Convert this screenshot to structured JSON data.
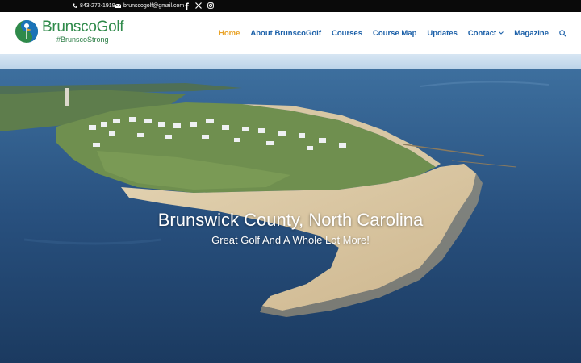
{
  "topbar": {
    "phone": "843-272-1919",
    "email": "brunscogolf@gmail.com",
    "social": [
      "facebook-icon",
      "x-icon",
      "instagram-icon"
    ]
  },
  "header": {
    "logo_title": "BrunscoGolf",
    "logo_tagline": "#BrunscoStrong",
    "nav": [
      {
        "label": "Home",
        "active": true
      },
      {
        "label": "About BrunscoGolf"
      },
      {
        "label": "Courses"
      },
      {
        "label": "Course Map"
      },
      {
        "label": "Updates"
      },
      {
        "label": "Contact",
        "dropdown": true
      },
      {
        "label": "Magazine"
      }
    ]
  },
  "hero": {
    "title": "Brunswick County, North Carolina",
    "subtitle": "Great Golf And A Whole Lot More!"
  },
  "colors": {
    "nav_link": "#1a5fa8",
    "nav_active": "#e9a328",
    "logo_green": "#2f8a4a",
    "topbar_bg": "#0a0a0a"
  }
}
